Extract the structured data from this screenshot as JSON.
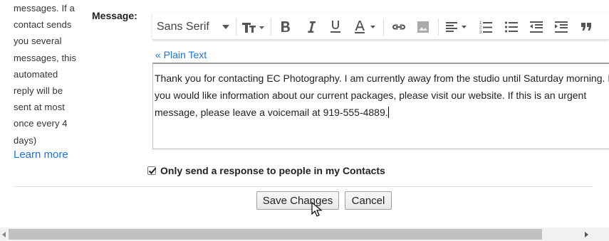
{
  "help_text": {
    "lines": [
      "messages. If a",
      "contact sends",
      "you several",
      "messages, this",
      "automated",
      "reply will be",
      "sent at most",
      "once every 4",
      "days)"
    ],
    "learn_more": "Learn more"
  },
  "message_label": "Message:",
  "toolbar": {
    "font": "Sans Serif",
    "icons": [
      "font-size-icon",
      "bold-icon",
      "italic-icon",
      "underline-icon",
      "text-color-icon",
      "link-icon",
      "image-icon",
      "align-icon",
      "numbered-list-icon",
      "bulleted-list-icon",
      "indent-less-icon",
      "indent-more-icon",
      "quote-icon"
    ]
  },
  "plain_text_link": "« Plain Text",
  "message_body": {
    "lines": [
      "Thank you for contacting EC Photography. I am currently away from the studio until Saturday morning. If",
      "you would like information about our current packages, please visit our website. If this is an urgent",
      "message, please leave a voicemail at 919-555-4889."
    ]
  },
  "contacts_only": {
    "label": "Only send a response to people in my Contacts",
    "checked": true
  },
  "buttons": {
    "save": "Save Changes",
    "cancel": "Cancel"
  },
  "scrollbar": {
    "position_fraction": 0.0
  }
}
